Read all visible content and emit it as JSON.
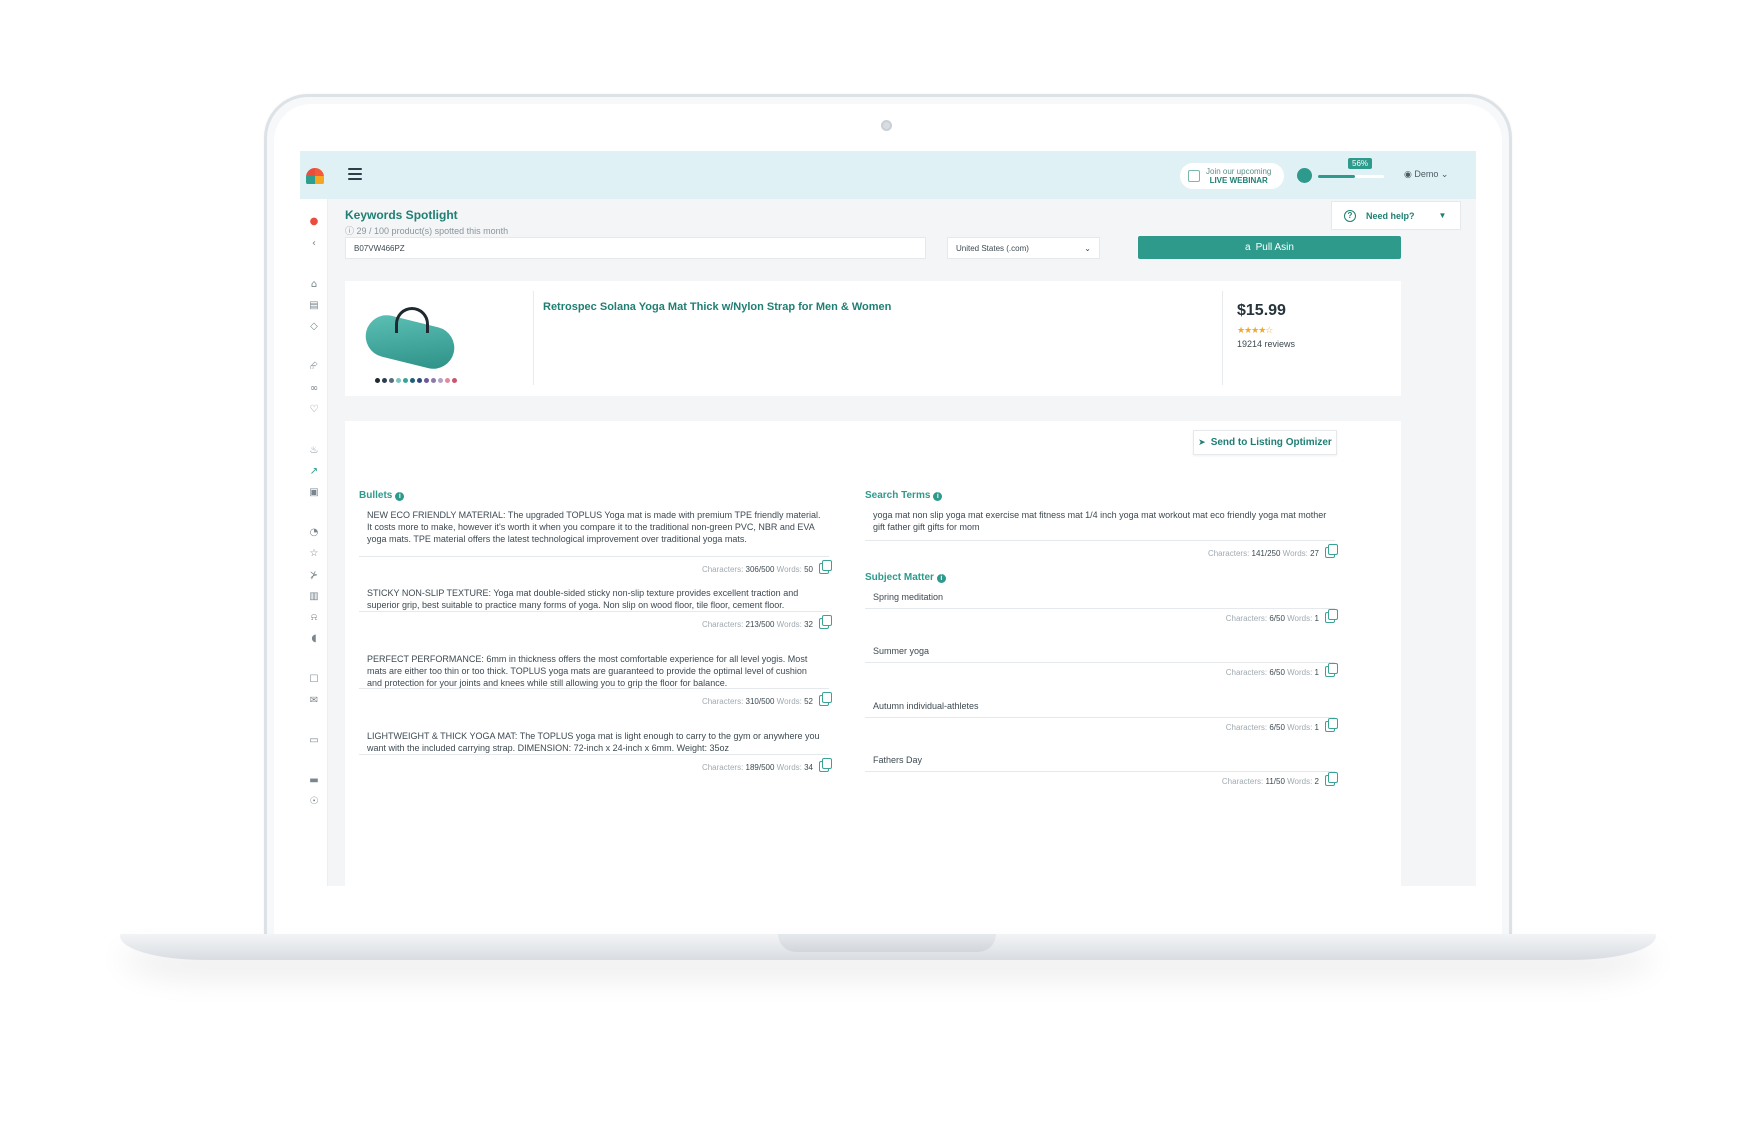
{
  "topbar": {
    "webinar_line1": "Join our upcoming",
    "webinar_line2": "LIVE WEBINAR",
    "progress_label": "56%",
    "progress_value": 0.56,
    "user_label": "Demo"
  },
  "page": {
    "title": "Keywords Spotlight",
    "subtitle": "29 / 100 product(s) spotted this month",
    "help_label": "Need help?"
  },
  "search": {
    "asin_value": "B07VW466PZ",
    "marketplace": "United States (.com)",
    "pull_label": "Pull Asin"
  },
  "product": {
    "title": "Retrospec Solana Yoga Mat Thick w/Nylon Strap for Men & Women",
    "price": "$15.99",
    "rating": 4.5,
    "reviews": "19214 reviews",
    "swatch_colors": [
      "#1d2a30",
      "#2c3e50",
      "#5a6b7a",
      "#7fc4c0",
      "#3aa396",
      "#1f5f7a",
      "#2e4a7a",
      "#6a5a9a",
      "#8a7aa8",
      "#b4a0c8",
      "#e28aa0",
      "#c9566f"
    ]
  },
  "details": {
    "send_label": "Send to Listing Optimizer",
    "bullets_label": "Bullets",
    "search_terms_label": "Search Terms",
    "subject_matter_label": "Subject Matter",
    "chars_prefix": "Characters: ",
    "words_prefix": " Words: ",
    "bullets": [
      {
        "text": "NEW ECO FRIENDLY MATERIAL: The upgraded TOPLUS Yoga mat is made with premium TPE friendly material. It costs more to make, however it's worth it when you compare it to the traditional non-green PVC, NBR and EVA yoga mats. TPE material offers the latest technological improvement over traditional yoga mats.",
        "chars": "306/500",
        "words": "50"
      },
      {
        "text": "STICKY NON-SLIP TEXTURE: Yoga mat double-sided sticky non-slip texture provides excellent traction and superior grip, best suitable to practice many forms of yoga. Non slip on wood floor, tile floor, cement floor.",
        "chars": "213/500",
        "words": "32"
      },
      {
        "text": "PERFECT PERFORMANCE: 6mm in thickness offers the most comfortable experience for all level yogis. Most mats are either too thin or too thick. TOPLUS yoga mats are guaranteed to provide the optimal level of cushion and protection for your joints and knees while still allowing you to grip the floor for balance.",
        "chars": "310/500",
        "words": "52"
      },
      {
        "text": "LIGHTWEIGHT & THICK YOGA MAT: The TOPLUS yoga mat is light enough to carry to the gym or anywhere you want with the included carrying strap. DIMENSION: 72-inch x 24-inch x 6mm. Weight: 35oz",
        "chars": "189/500",
        "words": "34"
      }
    ],
    "search_terms": {
      "text": "yoga mat non slip yoga mat exercise mat fitness mat 1/4 inch yoga mat workout mat eco friendly yoga mat mother gift father gift gifts for mom",
      "chars": "141/250",
      "words": "27"
    },
    "subject_matter": [
      {
        "text": "Spring  meditation",
        "chars": "6/50",
        "words": "1"
      },
      {
        "text": "Summer  yoga",
        "chars": "6/50",
        "words": "1"
      },
      {
        "text": "Autumn  individual-athletes",
        "chars": "6/50",
        "words": "1"
      },
      {
        "text": "Fathers Day",
        "chars": "11/50",
        "words": "2"
      }
    ]
  },
  "sidebar_icons": [
    "alert-bell-icon",
    "share-icon",
    "graduation-cap-icon",
    "book-icon",
    "diamond-icon",
    "tag-icon",
    "glasses-icon",
    "heart-icon",
    "fire-icon",
    "rocket-icon",
    "image-icon",
    "speedometer-icon",
    "star-icon",
    "cart-icon",
    "ledger-icon",
    "bell-icon",
    "shield-icon",
    "inbox-icon",
    "mail-icon",
    "chat-icon",
    "car-icon",
    "support-icon"
  ]
}
